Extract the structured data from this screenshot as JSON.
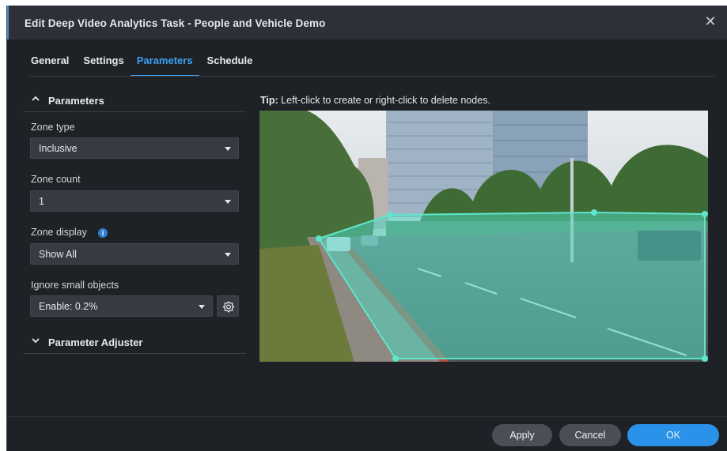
{
  "dialog": {
    "title": "Edit Deep Video Analytics Task - People and Vehicle Demo",
    "close_symbol": "✕"
  },
  "tabs": [
    {
      "label": "General",
      "active": false
    },
    {
      "label": "Settings",
      "active": false
    },
    {
      "label": "Parameters",
      "active": true
    },
    {
      "label": "Schedule",
      "active": false
    }
  ],
  "parameters": {
    "section_title": "Parameters",
    "zone_type": {
      "label": "Zone type",
      "value": "Inclusive"
    },
    "zone_count": {
      "label": "Zone count",
      "value": "1"
    },
    "zone_display": {
      "label": "Zone display",
      "value": "Show All",
      "info_icon": "i"
    },
    "ignore_small": {
      "label": "Ignore small objects",
      "value": "Enable: 0.2%"
    }
  },
  "adjuster": {
    "section_title": "Parameter Adjuster"
  },
  "tip": {
    "prefix": "Tip:",
    "text": " Left-click to create or right-click to delete nodes."
  },
  "footer": {
    "apply_label": "Apply",
    "cancel_label": "Cancel",
    "ok_label": "OK"
  },
  "colors": {
    "accent": "#3ea0f0",
    "zone_fill": "#4fd6c0",
    "ok_button": "#2a92e8"
  },
  "icons": {
    "close": "close-icon",
    "collapse": "chevron-up-icon",
    "expand": "chevron-down-icon",
    "info": "info-icon",
    "settings": "gear-icon"
  }
}
